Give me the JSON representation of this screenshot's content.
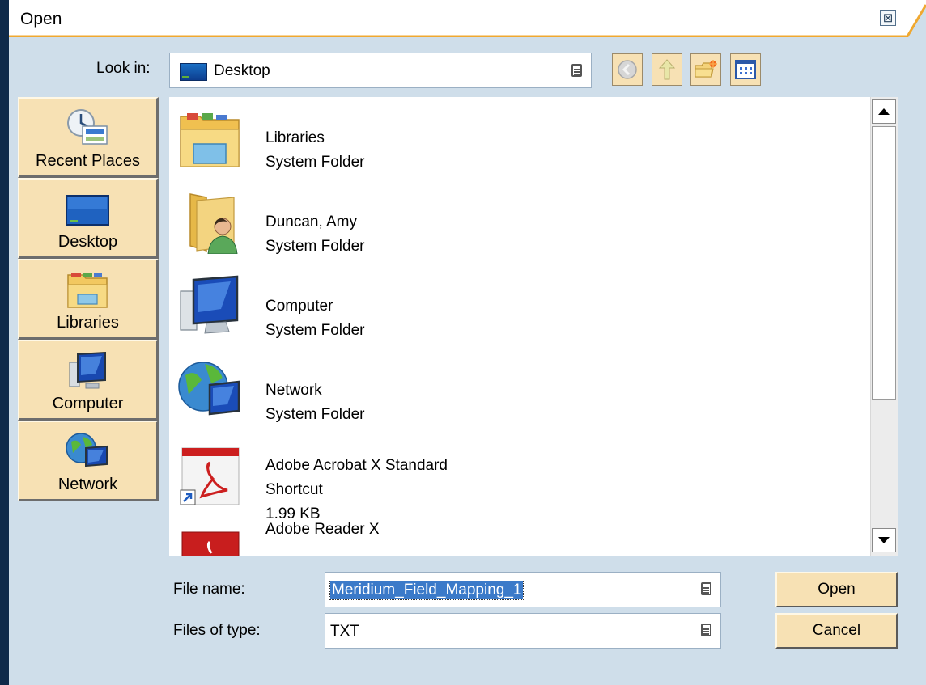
{
  "window": {
    "title": "Open",
    "close_glyph": "⊠"
  },
  "look_in": {
    "label": "Look in:",
    "value": "Desktop"
  },
  "toolbar": {
    "buttons": [
      {
        "name": "back-button",
        "icon": "back-arrow-icon"
      },
      {
        "name": "up-one-level-button",
        "icon": "up-arrow-icon"
      },
      {
        "name": "new-folder-button",
        "icon": "new-folder-icon"
      },
      {
        "name": "view-menu-button",
        "icon": "view-grid-icon"
      }
    ]
  },
  "places": [
    {
      "label": "Recent Places",
      "icon": "recent-places-icon"
    },
    {
      "label": "Desktop",
      "icon": "desktop-icon"
    },
    {
      "label": "Libraries",
      "icon": "libraries-icon"
    },
    {
      "label": "Computer",
      "icon": "computer-icon"
    },
    {
      "label": "Network",
      "icon": "network-icon"
    }
  ],
  "files": [
    {
      "name": "Libraries",
      "type": "System Folder",
      "icon": "libraries-folder-icon"
    },
    {
      "name": "Duncan, Amy",
      "type": "System Folder",
      "icon": "user-folder-icon"
    },
    {
      "name": "Computer",
      "type": "System Folder",
      "icon": "computer-icon"
    },
    {
      "name": "Network",
      "type": "System Folder",
      "icon": "network-icon"
    },
    {
      "name": "Adobe Acrobat X Standard",
      "type": "Shortcut",
      "size": "1.99 KB",
      "icon": "pdf-shortcut-icon"
    },
    {
      "name": "Adobe Reader X",
      "icon": "pdf-reader-icon"
    }
  ],
  "file_name": {
    "label": "File name:",
    "value": "Meridium_Field_Mapping_1"
  },
  "file_type": {
    "label": "Files of type:",
    "value": "TXT"
  },
  "buttons": {
    "open": "Open",
    "cancel": "Cancel"
  },
  "colors": {
    "accent": "#f7e1b4",
    "dialog_bg": "#cfdeea",
    "title_stripe": "#f0a830",
    "selection": "#3b7ac9"
  }
}
